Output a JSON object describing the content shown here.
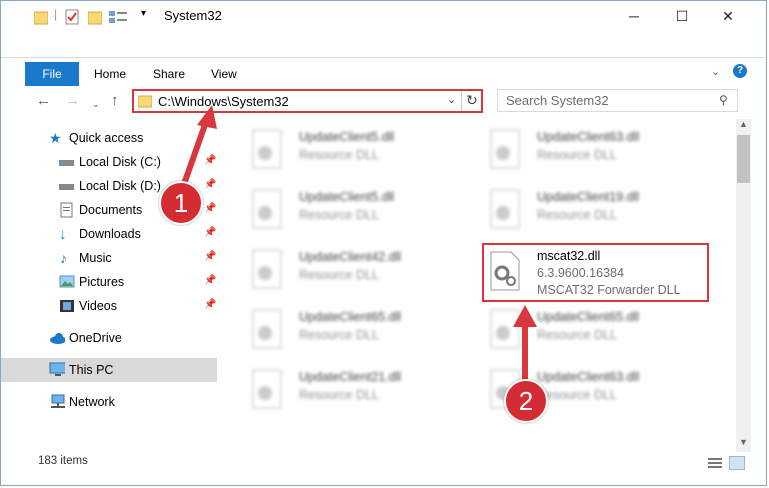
{
  "window": {
    "title": "System32",
    "minimize": "─",
    "maximize": "☐",
    "close": "✕"
  },
  "ribbon": {
    "file": "File",
    "tabs": [
      "Home",
      "Share",
      "View"
    ]
  },
  "address": {
    "path": "C:\\Windows\\System32"
  },
  "search": {
    "placeholder": "Search System32"
  },
  "nav": {
    "quick_access": "Quick access",
    "items": [
      {
        "label": "Local Disk (C:)",
        "icon": "drive-icon"
      },
      {
        "label": "Local Disk (D:)",
        "icon": "drive-icon"
      },
      {
        "label": "Documents",
        "icon": "documents-icon"
      },
      {
        "label": "Downloads",
        "icon": "downloads-icon"
      },
      {
        "label": "Music",
        "icon": "music-icon"
      },
      {
        "label": "Pictures",
        "icon": "pictures-icon"
      },
      {
        "label": "Videos",
        "icon": "videos-icon"
      }
    ],
    "onedrive": "OneDrive",
    "this_pc": "This PC",
    "network": "Network"
  },
  "files": [
    {
      "name": "UpdateClient5.dll",
      "desc": "Resource DLL"
    },
    {
      "name": "UpdateClient63.dll",
      "desc": "Resource DLL"
    },
    {
      "name": "UpdateClient5.dll",
      "desc": "Resource DLL"
    },
    {
      "name": "UpdateClient19.dll",
      "desc": "Resource DLL"
    },
    {
      "name": "UpdateClient42.dll",
      "desc": "Resource DLL"
    },
    {
      "name": "mscat32.dll",
      "version": "6.3.9600.16384",
      "desc": "MSCAT32 Forwarder DLL"
    },
    {
      "name": "UpdateClient65.dll",
      "desc": "Resource DLL"
    },
    {
      "name": "UpdateClient65.dll",
      "desc": "Resource DLL"
    },
    {
      "name": "UpdateClient21.dll",
      "desc": "Resource DLL"
    },
    {
      "name": "UpdateClient63.dll",
      "desc": "Resource DLL"
    }
  ],
  "status": {
    "count": "183 items"
  },
  "annotations": {
    "one": "1",
    "two": "2",
    "color": "#d9363e"
  }
}
